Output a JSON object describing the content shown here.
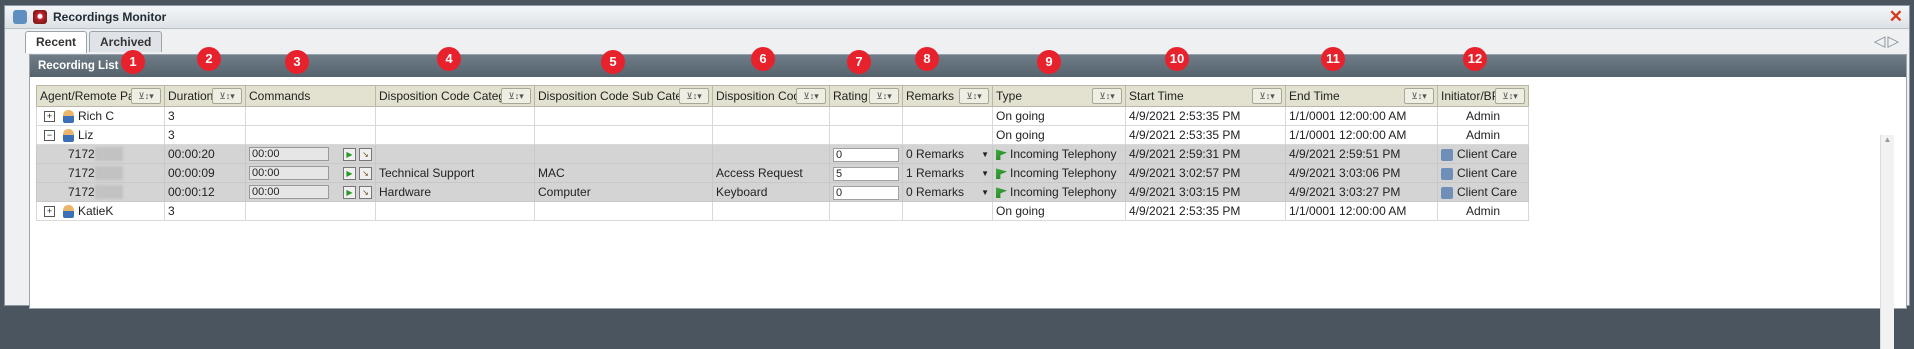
{
  "window": {
    "title": "Recordings Monitor",
    "close_glyph": "✕"
  },
  "tabs": [
    {
      "label": "Recent",
      "active": true
    },
    {
      "label": "Archived",
      "active": false
    }
  ],
  "nav_arrows": "◁▷",
  "panel": {
    "title": "Recording List"
  },
  "columns": [
    {
      "label": "Agent/Remote Party",
      "filter": "⊻↕▾"
    },
    {
      "label": "Duration",
      "filter": "⊻↕▾"
    },
    {
      "label": "Commands",
      "filter": ""
    },
    {
      "label": "Disposition Code Category",
      "filter": "⊻↕▾"
    },
    {
      "label": "Disposition Code Sub Category",
      "filter": "⊻↕▾"
    },
    {
      "label": "Disposition Code",
      "filter": "⊻↕▾"
    },
    {
      "label": "Rating",
      "filter": "⊻↕▾"
    },
    {
      "label": "Remarks",
      "filter": "⊻↕▾"
    },
    {
      "label": "Type",
      "filter": "⊻↕▾"
    },
    {
      "label": "Start Time",
      "filter": "⊻↕▾"
    },
    {
      "label": "End Time",
      "filter": "⊻↕▾"
    },
    {
      "label": "Initiator/BP",
      "filter": "⊻↕▾"
    }
  ],
  "badges": [
    "1",
    "2",
    "3",
    "4",
    "5",
    "6",
    "7",
    "8",
    "9",
    "10",
    "11",
    "12"
  ],
  "rows": [
    {
      "kind": "parent",
      "expander": "+",
      "agent": "Rich C",
      "duration": "3",
      "type": "On going",
      "start": "4/9/2021 2:53:35 PM",
      "end": "1/1/0001 12:00:00 AM",
      "initiator": "Admin"
    },
    {
      "kind": "parent",
      "expander": "−",
      "agent": "Liz",
      "duration": "3",
      "type": "On going",
      "start": "4/9/2021 2:53:35 PM",
      "end": "1/1/0001 12:00:00 AM",
      "initiator": "Admin"
    },
    {
      "kind": "child",
      "party": "7172",
      "duration": "00:00:20",
      "command": "00:00",
      "category": "",
      "subcategory": "",
      "code": "",
      "rating": "0",
      "remarks": "0 Remarks",
      "type": "Incoming Telephony",
      "start": "4/9/2021 2:59:31 PM",
      "end": "4/9/2021 2:59:51 PM",
      "initiator": "Client Care"
    },
    {
      "kind": "child",
      "party": "7172",
      "duration": "00:00:09",
      "command": "00:00",
      "category": "Technical Support",
      "subcategory": "MAC",
      "code": "Access Request",
      "rating": "5",
      "remarks": "1 Remarks",
      "type": "Incoming Telephony",
      "start": "4/9/2021 3:02:57 PM",
      "end": "4/9/2021 3:03:06 PM",
      "initiator": "Client Care"
    },
    {
      "kind": "child",
      "party": "7172",
      "duration": "00:00:12",
      "command": "00:00",
      "category": "Hardware",
      "subcategory": "Computer",
      "code": "Keyboard",
      "rating": "0",
      "remarks": "0 Remarks",
      "type": "Incoming Telephony",
      "start": "4/9/2021 3:03:15 PM",
      "end": "4/9/2021 3:03:27 PM",
      "initiator": "Client Care"
    },
    {
      "kind": "parent",
      "expander": "+",
      "agent": "KatieK",
      "duration": "3",
      "type": "On going",
      "start": "4/9/2021 2:53:35 PM",
      "end": "1/1/0001 12:00:00 AM",
      "initiator": "Admin"
    }
  ]
}
